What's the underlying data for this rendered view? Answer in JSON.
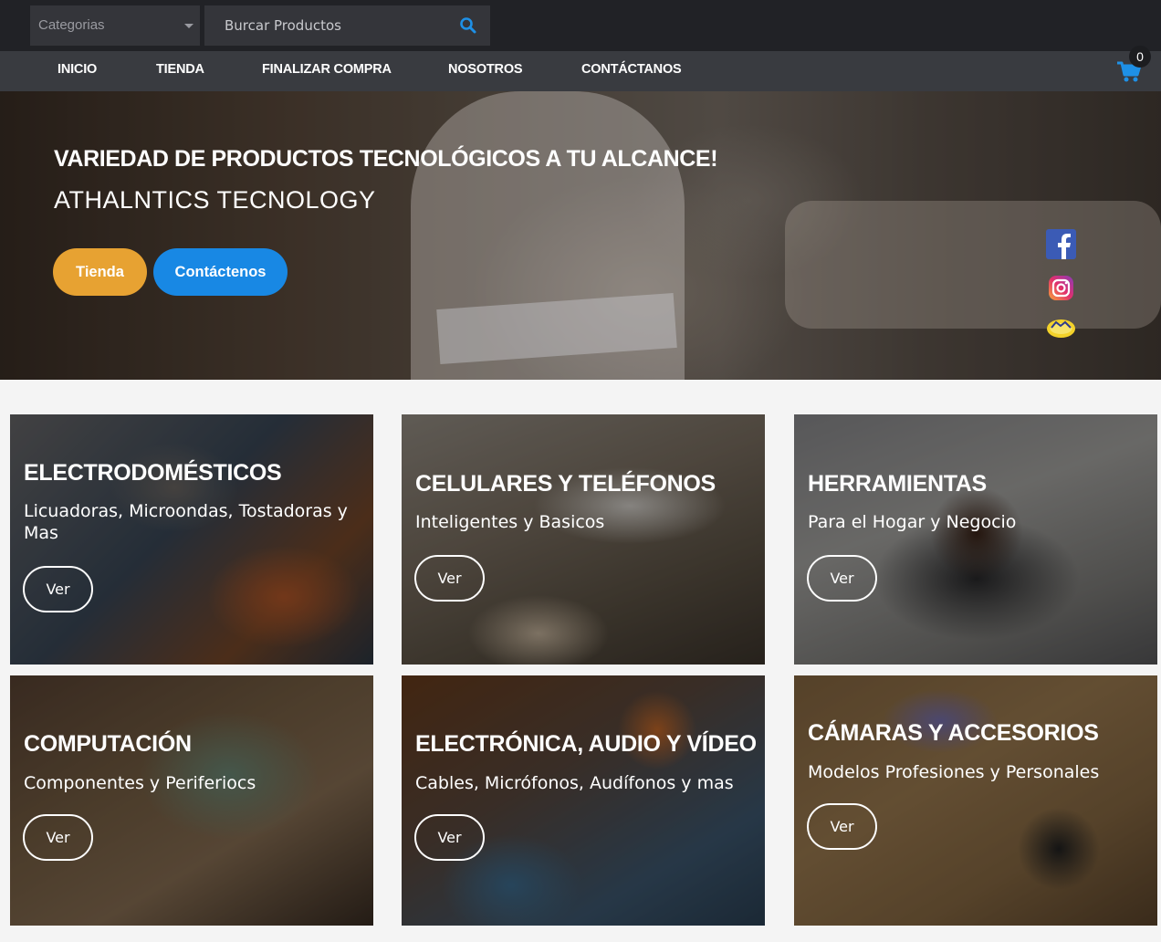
{
  "header": {
    "categories_label": "Categorias",
    "search_placeholder": "Burcar Productos"
  },
  "nav": {
    "items": [
      {
        "label": "INICIO"
      },
      {
        "label": "TIENDA"
      },
      {
        "label": "FINALIZAR COMPRA"
      },
      {
        "label": "NOSOTROS"
      },
      {
        "label": "CONTÁCTANOS"
      }
    ],
    "cart_count": "0"
  },
  "hero": {
    "title": "VARIEDAD DE PRODUCTOS TECNOLÓGICOS A TU ALCANCE!",
    "subtitle": "ATHALNTICS TECNOLOGY",
    "btn_tienda": "Tienda",
    "btn_contact": "Contáctenos"
  },
  "social": [
    "facebook-icon",
    "instagram-icon",
    "whatsapp-icon"
  ],
  "cards": [
    {
      "title": "ELECTRODOMÉSTICOS",
      "desc": "Licuadoras, Microondas, Tostadoras y Mas",
      "btn": "Ver"
    },
    {
      "title": "CELULARES Y TELÉFONOS",
      "desc": "Inteligentes y Basicos",
      "btn": "Ver"
    },
    {
      "title": "HERRAMIENTAS",
      "desc": "Para el Hogar y Negocio",
      "btn": "Ver"
    },
    {
      "title": "COMPUTACIÓN",
      "desc": "Componentes y Periferiocs",
      "btn": "Ver"
    },
    {
      "title": "ELECTRÓNICA, AUDIO Y VÍDEO",
      "desc": "Cables, Micrófonos, Audífonos y mas",
      "btn": "Ver"
    },
    {
      "title": "CÁMARAS Y ACCESORIOS",
      "desc": "Modelos Profesiones y Personales",
      "btn": "Ver"
    }
  ],
  "colors": {
    "accent_orange": "#e7a232",
    "accent_blue": "#1888e4",
    "topbar_bg": "#212226",
    "navbar_bg": "#393b40"
  }
}
